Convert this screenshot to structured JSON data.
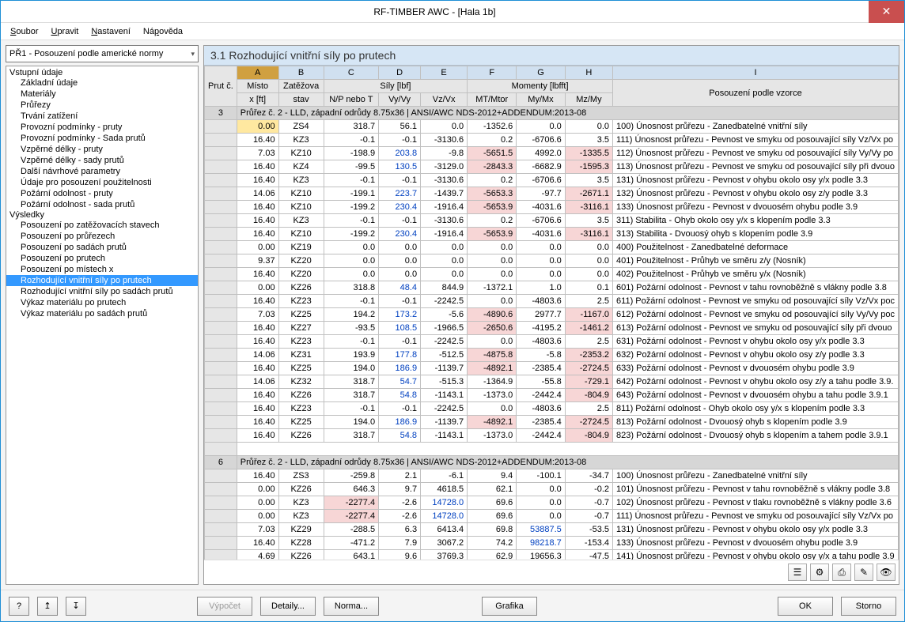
{
  "window": {
    "title": "RF-TIMBER AWC - [Hala 1b]"
  },
  "menu": {
    "items": [
      "Soubor",
      "Upravit",
      "Nastavení",
      "Nápověda"
    ],
    "underlines": [
      0,
      0,
      0,
      2
    ]
  },
  "combo": {
    "value": "PŘ1 - Posouzení podle americké normy"
  },
  "tree": {
    "groups": [
      {
        "label": "Vstupní údaje",
        "items": [
          "Základní údaje",
          "Materiály",
          "Průřezy",
          "Trvání zatížení",
          "Provozní podmínky - pruty",
          "Provozní podmínky - Sada prutů",
          "Vzpěrné délky - pruty",
          "Vzpěrné délky - sady prutů",
          "Další návrhové parametry",
          "Údaje pro posouzení použitelnosti",
          "Požární odolnost - pruty",
          "Požární odolnost - sada prutů"
        ]
      },
      {
        "label": "Výsledky",
        "items": [
          "Posouzení po zatěžovacích stavech",
          "Posouzení po průřezech",
          "Posouzení po sadách prutů",
          "Posouzení po prutech",
          "Posouzení po místech x",
          "Rozhodující vnitřní síly po prutech",
          "Rozhodující vnitřní síly po sadách prutů",
          "Výkaz materiálu po prutech",
          "Výkaz materiálu po sadách prutů"
        ],
        "selected": 5
      }
    ]
  },
  "panel": {
    "title": "3.1  Rozhodující vnitřní síly po prutech"
  },
  "grid": {
    "letters": [
      "A",
      "B",
      "C",
      "D",
      "E",
      "F",
      "G",
      "H",
      "I"
    ],
    "selectedLetter": 0,
    "header1": {
      "prut": "Prut č.",
      "misto": "Místo x [ft]",
      "zatezova": "Zatěžova stav",
      "sily": "Síly [lbf]",
      "momenty": "Momenty [lbfft]",
      "np": "N/P nebo T",
      "vy": "Vy/Vy",
      "vz": "Vz/Vx",
      "mt": "MT/Mtor",
      "my": "My/Mx",
      "mz": "Mz/My",
      "pos": "Posouzení podle vzorce"
    },
    "sections": [
      {
        "prut": "3",
        "title": "Průřez č.  2 - LLD, západní odrůdy 8.75x36 | ANSI/AWC NDS-2012+ADDENDUM:2013-08",
        "rows": [
          {
            "x": "0.00",
            "st": "ZS4",
            "c": "318.7",
            "d": "56.1",
            "e": "0.0",
            "f": "-1352.6",
            "g": "0.0",
            "h": "0.0",
            "desc": "100) Únosnost průřezu - Zanedbatelné vnitřní síly",
            "sel": true
          },
          {
            "x": "16.40",
            "st": "KZ3",
            "c": "-0.1",
            "d": "-0.1",
            "e": "-3130.6",
            "f": "0.2",
            "g": "-6706.6",
            "h": "3.5",
            "desc": "111) Únosnost průřezu - Pevnost ve smyku od posouvající síly Vz/Vx po"
          },
          {
            "x": "7.03",
            "st": "KZ10",
            "c": "-198.9",
            "d": "203.8",
            "e": "-9.8",
            "f": "-5651.5",
            "g": "4992.0",
            "h": "-1335.5",
            "desc": "112) Únosnost průřezu - Pevnost ve smyku od posouvající síly Vy/Vy po",
            "hl": {
              "d": "b",
              "f": "r",
              "h": "r"
            }
          },
          {
            "x": "16.40",
            "st": "KZ4",
            "c": "-99.5",
            "d": "130.5",
            "e": "-3129.0",
            "f": "-2843.3",
            "g": "-6682.9",
            "h": "-1595.3",
            "desc": "113) Únosnost průřezu - Pevnost ve smyku od posouvající síly při dvouo",
            "hl": {
              "d": "b",
              "f": "r",
              "h": "r"
            }
          },
          {
            "x": "16.40",
            "st": "KZ3",
            "c": "-0.1",
            "d": "-0.1",
            "e": "-3130.6",
            "f": "0.2",
            "g": "-6706.6",
            "h": "3.5",
            "desc": "131) Únosnost průřezu - Pevnost v ohybu okolo osy y/x podle 3.3"
          },
          {
            "x": "14.06",
            "st": "KZ10",
            "c": "-199.1",
            "d": "223.7",
            "e": "-1439.7",
            "f": "-5653.3",
            "g": "-97.7",
            "h": "-2671.1",
            "desc": "132) Únosnost průřezu - Pevnost v ohybu okolo osy z/y podle 3.3",
            "hl": {
              "d": "b",
              "f": "r",
              "h": "r"
            }
          },
          {
            "x": "16.40",
            "st": "KZ10",
            "c": "-199.2",
            "d": "230.4",
            "e": "-1916.4",
            "f": "-5653.9",
            "g": "-4031.6",
            "h": "-3116.1",
            "desc": "133) Únosnost průřezu - Pevnost v dvouosém ohybu podle 3.9",
            "hl": {
              "d": "b",
              "f": "r",
              "h": "r"
            }
          },
          {
            "x": "16.40",
            "st": "KZ3",
            "c": "-0.1",
            "d": "-0.1",
            "e": "-3130.6",
            "f": "0.2",
            "g": "-6706.6",
            "h": "3.5",
            "desc": "311) Stabilita - Ohyb okolo osy y/x s klopením podle 3.3"
          },
          {
            "x": "16.40",
            "st": "KZ10",
            "c": "-199.2",
            "d": "230.4",
            "e": "-1916.4",
            "f": "-5653.9",
            "g": "-4031.6",
            "h": "-3116.1",
            "desc": "313) Stabilita - Dvouosý ohyb s klopením podle 3.9",
            "hl": {
              "d": "b",
              "f": "r",
              "h": "r"
            }
          },
          {
            "x": "0.00",
            "st": "KZ19",
            "c": "0.0",
            "d": "0.0",
            "e": "0.0",
            "f": "0.0",
            "g": "0.0",
            "h": "0.0",
            "desc": "400) Použitelnost - Zanedbatelné deformace"
          },
          {
            "x": "9.37",
            "st": "KZ20",
            "c": "0.0",
            "d": "0.0",
            "e": "0.0",
            "f": "0.0",
            "g": "0.0",
            "h": "0.0",
            "desc": "401) Použitelnost - Průhyb ve směru z/y (Nosník)"
          },
          {
            "x": "16.40",
            "st": "KZ20",
            "c": "0.0",
            "d": "0.0",
            "e": "0.0",
            "f": "0.0",
            "g": "0.0",
            "h": "0.0",
            "desc": "402) Použitelnost - Průhyb ve směru y/x (Nosník)"
          },
          {
            "x": "0.00",
            "st": "KZ26",
            "c": "318.8",
            "d": "48.4",
            "e": "844.9",
            "f": "-1372.1",
            "g": "1.0",
            "h": "0.1",
            "desc": "601) Požární odolnost - Pevnost v tahu rovnoběžně s vlákny podle 3.8",
            "hl": {
              "d": "b"
            }
          },
          {
            "x": "16.40",
            "st": "KZ23",
            "c": "-0.1",
            "d": "-0.1",
            "e": "-2242.5",
            "f": "0.0",
            "g": "-4803.6",
            "h": "2.5",
            "desc": "611) Požární odolnost - Pevnost ve smyku od posouvající síly Vz/Vx poc"
          },
          {
            "x": "7.03",
            "st": "KZ25",
            "c": "194.2",
            "d": "173.2",
            "e": "-5.6",
            "f": "-4890.6",
            "g": "2977.7",
            "h": "-1167.0",
            "desc": "612) Požární odolnost - Pevnost ve smyku od posouvající síly Vy/Vy poc",
            "hl": {
              "d": "b",
              "f": "r",
              "h": "r"
            }
          },
          {
            "x": "16.40",
            "st": "KZ27",
            "c": "-93.5",
            "d": "108.5",
            "e": "-1966.5",
            "f": "-2650.6",
            "g": "-4195.2",
            "h": "-1461.2",
            "desc": "613) Požární odolnost - Pevnost ve smyku od posouvající síly při dvouo",
            "hl": {
              "d": "b",
              "f": "r",
              "h": "r"
            }
          },
          {
            "x": "16.40",
            "st": "KZ23",
            "c": "-0.1",
            "d": "-0.1",
            "e": "-2242.5",
            "f": "0.0",
            "g": "-4803.6",
            "h": "2.5",
            "desc": "631) Požární odolnost - Pevnost v ohybu okolo osy y/x podle 3.3"
          },
          {
            "x": "14.06",
            "st": "KZ31",
            "c": "193.9",
            "d": "177.8",
            "e": "-512.5",
            "f": "-4875.8",
            "g": "-5.8",
            "h": "-2353.2",
            "desc": "632) Požární odolnost - Pevnost v ohybu okolo osy z/y podle 3.3",
            "hl": {
              "d": "b",
              "f": "r",
              "h": "r"
            }
          },
          {
            "x": "16.40",
            "st": "KZ25",
            "c": "194.0",
            "d": "186.9",
            "e": "-1139.7",
            "f": "-4892.1",
            "g": "-2385.4",
            "h": "-2724.5",
            "desc": "633) Požární odolnost - Pevnost v dvouosém ohybu podle 3.9",
            "hl": {
              "d": "b",
              "f": "r",
              "h": "r"
            }
          },
          {
            "x": "14.06",
            "st": "KZ32",
            "c": "318.7",
            "d": "54.7",
            "e": "-515.3",
            "f": "-1364.9",
            "g": "-55.8",
            "h": "-729.1",
            "desc": "642) Požární odolnost - Pevnost v ohybu okolo osy z/y a tahu podle 3.9.",
            "hl": {
              "d": "b",
              "h": "r"
            }
          },
          {
            "x": "16.40",
            "st": "KZ26",
            "c": "318.7",
            "d": "54.8",
            "e": "-1143.1",
            "f": "-1373.0",
            "g": "-2442.4",
            "h": "-804.9",
            "desc": "643) Požární odolnost - Pevnost v dvouosém ohybu a tahu podle 3.9.1",
            "hl": {
              "d": "b",
              "h": "r"
            }
          },
          {
            "x": "16.40",
            "st": "KZ23",
            "c": "-0.1",
            "d": "-0.1",
            "e": "-2242.5",
            "f": "0.0",
            "g": "-4803.6",
            "h": "2.5",
            "desc": "811) Požární odolnost - Ohyb okolo osy y/x s klopením podle 3.3"
          },
          {
            "x": "16.40",
            "st": "KZ25",
            "c": "194.0",
            "d": "186.9",
            "e": "-1139.7",
            "f": "-4892.1",
            "g": "-2385.4",
            "h": "-2724.5",
            "desc": "813) Požární odolnost - Dvouosý ohyb s klopením podle 3.9",
            "hl": {
              "d": "b",
              "f": "r",
              "h": "r"
            }
          },
          {
            "x": "16.40",
            "st": "KZ26",
            "c": "318.7",
            "d": "54.8",
            "e": "-1143.1",
            "f": "-1373.0",
            "g": "-2442.4",
            "h": "-804.9",
            "desc": "823) Požární odolnost - Dvouosý ohyb s klopením a tahem podle 3.9.1",
            "hl": {
              "d": "b",
              "h": "r"
            }
          }
        ]
      },
      {
        "prut": "6",
        "title": "Průřez č.  2 - LLD, západní odrůdy 8.75x36 | ANSI/AWC NDS-2012+ADDENDUM:2013-08",
        "rows": [
          {
            "x": "16.40",
            "st": "ZS3",
            "c": "-259.8",
            "d": "2.1",
            "e": "-6.1",
            "f": "9.4",
            "g": "-100.1",
            "h": "-34.7",
            "desc": "100) Únosnost průřezu - Zanedbatelné vnitřní síly"
          },
          {
            "x": "0.00",
            "st": "KZ26",
            "c": "646.3",
            "d": "9.7",
            "e": "4618.5",
            "f": "62.1",
            "g": "0.0",
            "h": "-0.2",
            "desc": "101) Únosnost průřezu - Pevnost v tahu rovnoběžně s vlákny podle 3.8"
          },
          {
            "x": "0.00",
            "st": "KZ3",
            "c": "-2277.4",
            "d": "-2.6",
            "e": "14728.0",
            "f": "69.6",
            "g": "0.0",
            "h": "-0.7",
            "desc": "102) Únosnost průřezu - Pevnost v tlaku rovnoběžně s vlákny podle 3.6",
            "hl": {
              "c": "r",
              "e": "b"
            }
          },
          {
            "x": "0.00",
            "st": "KZ3",
            "c": "-2277.4",
            "d": "-2.6",
            "e": "14728.0",
            "f": "69.6",
            "g": "0.0",
            "h": "-0.7",
            "desc": "111) Únosnost průřezu - Pevnost ve smyku od posouvající síly Vz/Vx po",
            "hl": {
              "c": "r",
              "e": "b"
            }
          },
          {
            "x": "7.03",
            "st": "KZ29",
            "c": "-288.5",
            "d": "6.3",
            "e": "6413.4",
            "f": "69.8",
            "g": "53887.5",
            "h": "-53.5",
            "desc": "131) Únosnost průřezu - Pevnost v ohybu okolo osy y/x podle 3.3",
            "hl": {
              "g": "b"
            }
          },
          {
            "x": "16.40",
            "st": "KZ28",
            "c": "-471.2",
            "d": "7.9",
            "e": "3067.2",
            "f": "74.2",
            "g": "98218.7",
            "h": "-153.4",
            "desc": "133) Únosnost průřezu - Pevnost v dvouosém ohybu podle 3.9",
            "hl": {
              "g": "b"
            }
          },
          {
            "x": "4.69",
            "st": "KZ26",
            "c": "643.1",
            "d": "9.6",
            "e": "3769.3",
            "f": "62.9",
            "g": "19656.3",
            "h": "-47.5",
            "desc": "141) Únosnost průřezu - Pevnost v ohybu okolo osy y/x a tahu podle 3.9"
          }
        ]
      }
    ]
  },
  "footer": {
    "vypocet": "Výpočet",
    "detaily": "Detaily...",
    "norma": "Norma...",
    "grafika": "Grafika",
    "ok": "OK",
    "storno": "Storno"
  },
  "icons": {
    "help": "?",
    "exp1": "↥",
    "exp2": "↧",
    "t1": "☰",
    "t2": "⚙",
    "t3": "⎙",
    "t4": "✎",
    "t5": "👁"
  }
}
